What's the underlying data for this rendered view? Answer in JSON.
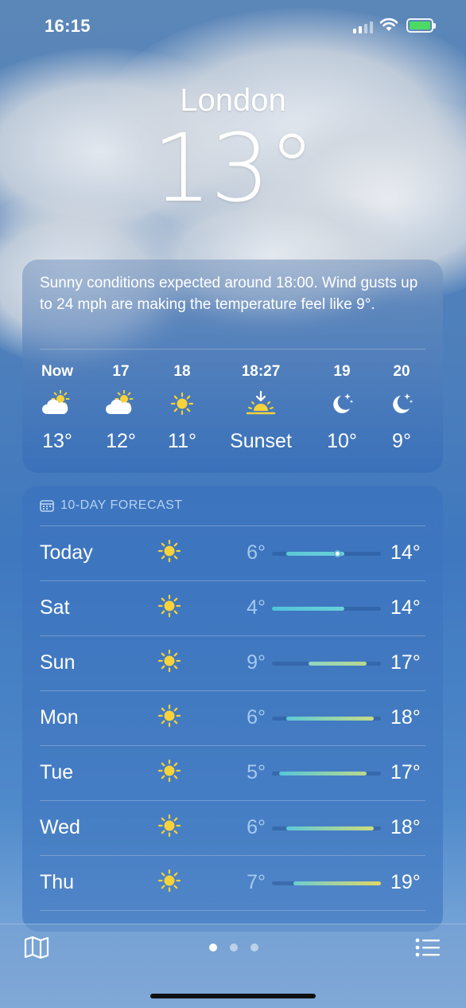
{
  "status_bar": {
    "time": "16:15"
  },
  "header": {
    "city": "London",
    "temperature": "13°"
  },
  "summary": "Sunny conditions expected around 18:00. Wind gusts up to 24 mph are making the temperature feel like 9°.",
  "hourly": [
    {
      "label": "Now",
      "icon": "partly-cloudy-day-icon",
      "value": "13°"
    },
    {
      "label": "17",
      "icon": "partly-cloudy-day-icon",
      "value": "12°"
    },
    {
      "label": "18",
      "icon": "sun-icon",
      "value": "11°"
    },
    {
      "label": "18:27",
      "icon": "sunset-icon",
      "value": "Sunset"
    },
    {
      "label": "19",
      "icon": "moon-stars-icon",
      "value": "10°"
    },
    {
      "label": "20",
      "icon": "moon-stars-icon",
      "value": "9°"
    }
  ],
  "daily": {
    "heading": "10-DAY FORECAST",
    "scale_min": 4,
    "scale_max": 19,
    "days": [
      {
        "day": "Today",
        "icon": "sun-icon",
        "low": "6°",
        "high": "14°",
        "low_val": 6,
        "high_val": 14,
        "current": 13,
        "grad_from": "#5cc8d6",
        "grad_to": "#6ad0d8"
      },
      {
        "day": "Sat",
        "icon": "sun-icon",
        "low": "4°",
        "high": "14°",
        "low_val": 4,
        "high_val": 14,
        "grad_from": "#52c3da",
        "grad_to": "#6ad0d8"
      },
      {
        "day": "Sun",
        "icon": "sun-icon",
        "low": "9°",
        "high": "17°",
        "low_val": 9,
        "high_val": 17,
        "grad_from": "#8fd3c4",
        "grad_to": "#b9d98e"
      },
      {
        "day": "Mon",
        "icon": "sun-icon",
        "low": "6°",
        "high": "18°",
        "low_val": 6,
        "high_val": 18,
        "grad_from": "#5ccad6",
        "grad_to": "#c6dc86"
      },
      {
        "day": "Tue",
        "icon": "sun-icon",
        "low": "5°",
        "high": "17°",
        "low_val": 5,
        "high_val": 17,
        "grad_from": "#56c6d8",
        "grad_to": "#b9d98e"
      },
      {
        "day": "Wed",
        "icon": "sun-icon",
        "low": "6°",
        "high": "18°",
        "low_val": 6,
        "high_val": 18,
        "grad_from": "#5ccad6",
        "grad_to": "#cfdc7c"
      },
      {
        "day": "Thu",
        "icon": "sun-icon",
        "low": "7°",
        "high": "19°",
        "low_val": 7,
        "high_val": 19,
        "grad_from": "#6ccdd0",
        "grad_to": "#e2d864"
      }
    ]
  },
  "bottom_bar": {
    "map_icon": "map-icon",
    "list_icon": "list-icon",
    "pages": 3,
    "active_page": 0
  }
}
